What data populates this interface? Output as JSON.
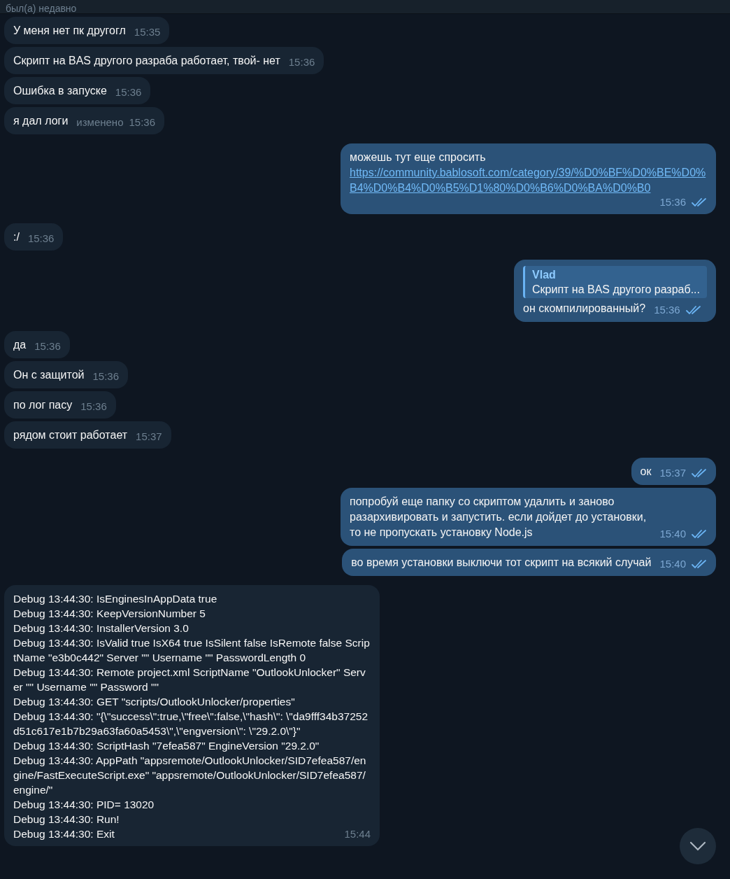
{
  "header": {
    "status": "был(а) недавно"
  },
  "groups": [
    {
      "outgoing": false,
      "messages": [
        {
          "text": "У меня нет пк другогл",
          "time": "15:35"
        },
        {
          "text": "Скрипт на BAS другого разраба работает, твой- нет",
          "time": "15:36"
        },
        {
          "text": "Ошибка в запуске",
          "time": "15:36"
        },
        {
          "text": "я дал логи",
          "edited": "изменено",
          "time": "15:36"
        }
      ]
    },
    {
      "outgoing": true,
      "messages": [
        {
          "text": "можешь тут еще спросить",
          "link": "https://community.bablosoft.com/category/39/%D0%BF%D0%BE%D0%B4%D0%B4%D0%B5%D1%80%D0%B6%D0%BA%D0%B0",
          "time": "15:36",
          "read": true
        }
      ]
    },
    {
      "outgoing": false,
      "messages": [
        {
          "text": ":/",
          "time": "15:36"
        }
      ]
    },
    {
      "outgoing": true,
      "messages": [
        {
          "reply": {
            "author": "Vlad",
            "text": "Скрипт на BAS другого разраб..."
          },
          "text": "он скомпилированный?",
          "time": "15:36",
          "read": true
        }
      ]
    },
    {
      "outgoing": false,
      "messages": [
        {
          "text": "да",
          "time": "15:36"
        },
        {
          "text": "Он с защитой",
          "time": "15:36"
        },
        {
          "text": "по лог пасу",
          "time": "15:36"
        },
        {
          "text": "рядом стоит работает",
          "time": "15:37"
        }
      ]
    },
    {
      "outgoing": true,
      "messages": [
        {
          "text": "ок",
          "time": "15:37",
          "read": true
        },
        {
          "text": "попробуй еще папку со скриптом удалить и заново разархивировать и запустить. если дойдет до установки, то не пропускать установку Node.js",
          "time": "15:40",
          "read": true
        },
        {
          "text": "во время установки выключи тот скрипт на всякий случай",
          "time": "15:40",
          "read": true
        }
      ]
    },
    {
      "outgoing": false,
      "messages": [
        {
          "lines": [
            "Debug 13:44:30: IsEnginesInAppData true",
            "Debug 13:44:30: KeepVersionNumber 5",
            "Debug 13:44:30: InstallerVersion 3.0",
            "Debug 13:44:30: IsValid true IsX64 true IsSilent false IsRemote false ScriptName \"e3b0c442\" Server \"\" Username \"\" PasswordLength 0",
            "Debug 13:44:30: Remote project.xml ScriptName \"OutlookUnlocker\" Server \"\" Username \"\" Password \"\"",
            "Debug 13:44:30: GET \"scripts/OutlookUnlocker/properties\"",
            "Debug 13:44:30: \"{\\\"success\\\":true,\\\"free\\\":false,\\\"hash\\\": \\\"da9fff34b37252d51c617e1b7b29a63fa60a5453\\\",\\\"engversion\\\": \\\"29.2.0\\\"}\"",
            "Debug 13:44:30: ScriptHash \"7efea587\" EngineVersion \"29.2.0\"",
            "Debug 13:44:30: AppPath \"appsremote/OutlookUnlocker/SID7efea587/engine/FastExecuteScript.exe\" \"appsremote/OutlookUnlocker/SID7efea587/engine/\"",
            "Debug 13:44:30: PID= 13020",
            "Debug 13:44:30: Run!",
            "Debug 13:44:30: Exit"
          ],
          "time": "15:44"
        }
      ]
    }
  ]
}
